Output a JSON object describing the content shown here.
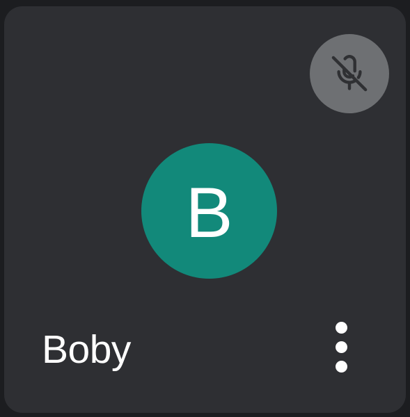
{
  "participant_tile": {
    "name": "Boby",
    "avatar_initial": "B",
    "avatar_color": "#12897a",
    "tile_color": "#2e2f33",
    "mic_status_icon": "mic-off-icon",
    "mute_badge_color": "#6e7073",
    "more_options_icon": "more-vertical-icon"
  }
}
